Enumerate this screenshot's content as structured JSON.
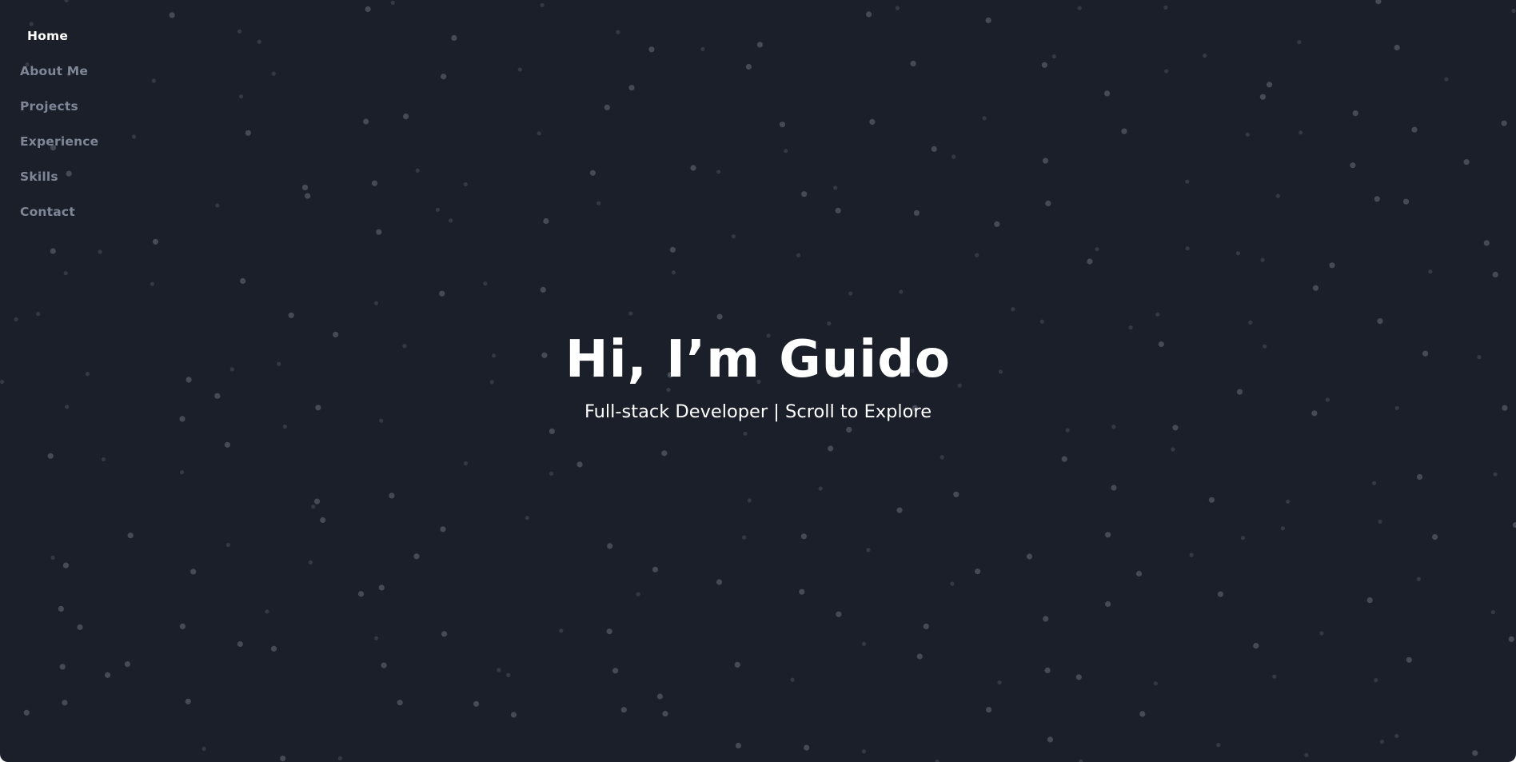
{
  "colors": {
    "background": "#1b1f2a",
    "nav_active": "#ffffff",
    "nav_inactive": "#7f8796",
    "star": "#4a4f5c",
    "hero_text": "#ffffff"
  },
  "nav": {
    "items": [
      {
        "label": "Home",
        "active": true
      },
      {
        "label": "About Me",
        "active": false
      },
      {
        "label": "Projects",
        "active": false
      },
      {
        "label": "Experience",
        "active": false
      },
      {
        "label": "Skills",
        "active": false
      },
      {
        "label": "Contact",
        "active": false
      }
    ]
  },
  "hero": {
    "title": "Hi, I’m Guido",
    "subtitle": "Full-stack Developer | Scroll to Explore"
  }
}
